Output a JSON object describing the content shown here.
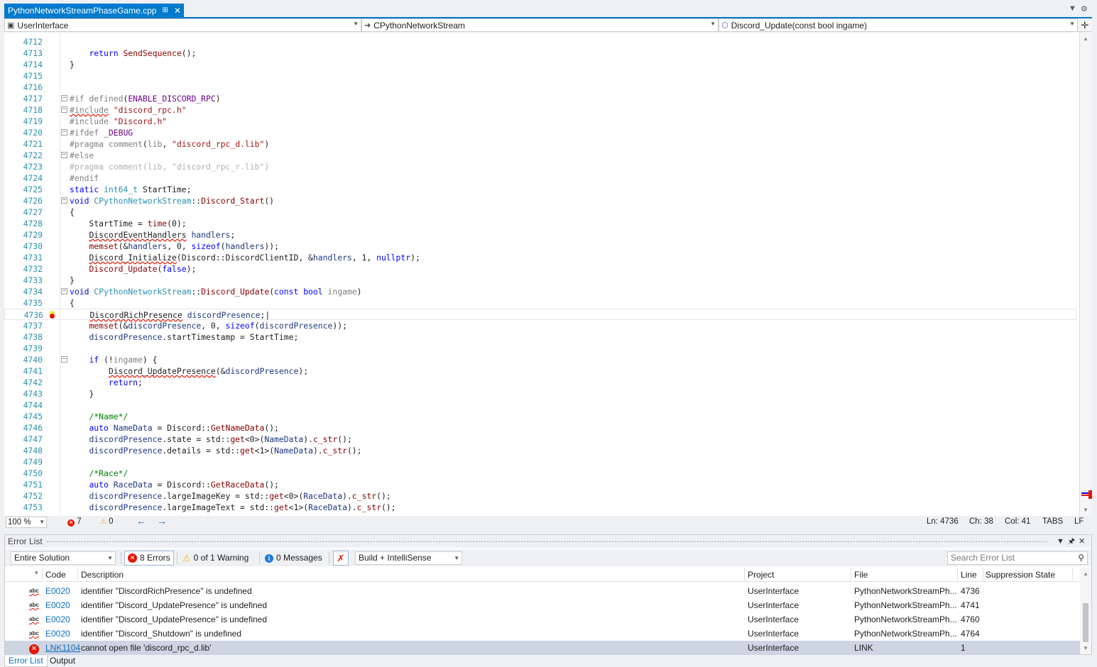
{
  "tab": {
    "filename": "PythonNetworkStreamPhaseGame.cpp"
  },
  "navbar": {
    "project": "UserInterface",
    "scope": "CPythonNetworkStream",
    "member": "Discord_Update(const bool ingame)"
  },
  "editor": {
    "first_line": 4712,
    "zoom": "100 %",
    "errors": "7",
    "warnings": "0",
    "ln": "Ln: 4736",
    "ch": "Ch: 38",
    "col": "Col: 41",
    "tabs": "TABS",
    "eol": "LF"
  },
  "error_list": {
    "title": "Error List",
    "scope": "Entire Solution",
    "errors_btn": "8 Errors",
    "warnings_btn": "0 of 1 Warning",
    "messages_btn": "0 Messages",
    "build_filter": "Build + IntelliSense",
    "search_placeholder": "Search Error List",
    "columns": [
      "Code",
      "Description",
      "Project",
      "File",
      "Line",
      "Suppression State"
    ],
    "rows": [
      {
        "icon": "intellisense-error-icon",
        "code": "E0020",
        "description": "identifier \"DiscordRichPresence\" is undefined",
        "project": "UserInterface",
        "file": "PythonNetworkStreamPh...",
        "line": "4736"
      },
      {
        "icon": "intellisense-error-icon",
        "code": "E0020",
        "description": "identifier \"Discord_UpdatePresence\" is undefined",
        "project": "UserInterface",
        "file": "PythonNetworkStreamPh...",
        "line": "4741"
      },
      {
        "icon": "intellisense-error-icon",
        "code": "E0020",
        "description": "identifier \"Discord_UpdatePresence\" is undefined",
        "project": "UserInterface",
        "file": "PythonNetworkStreamPh...",
        "line": "4760"
      },
      {
        "icon": "intellisense-error-icon",
        "code": "E0020",
        "description": "identifier \"Discord_Shutdown\" is undefined",
        "project": "UserInterface",
        "file": "PythonNetworkStreamPh...",
        "line": "4764"
      },
      {
        "icon": "build-error-icon",
        "code": "LNK1104",
        "description": "cannot open file 'discord_rpc_d.lib'",
        "project": "UserInterface",
        "file": "LINK",
        "line": "1"
      }
    ]
  },
  "bottom_tabs": [
    "Error List",
    "Output"
  ],
  "colors": {
    "accent": "#007acc",
    "error": "#e51400",
    "selection_row": "#cdd4e2"
  }
}
